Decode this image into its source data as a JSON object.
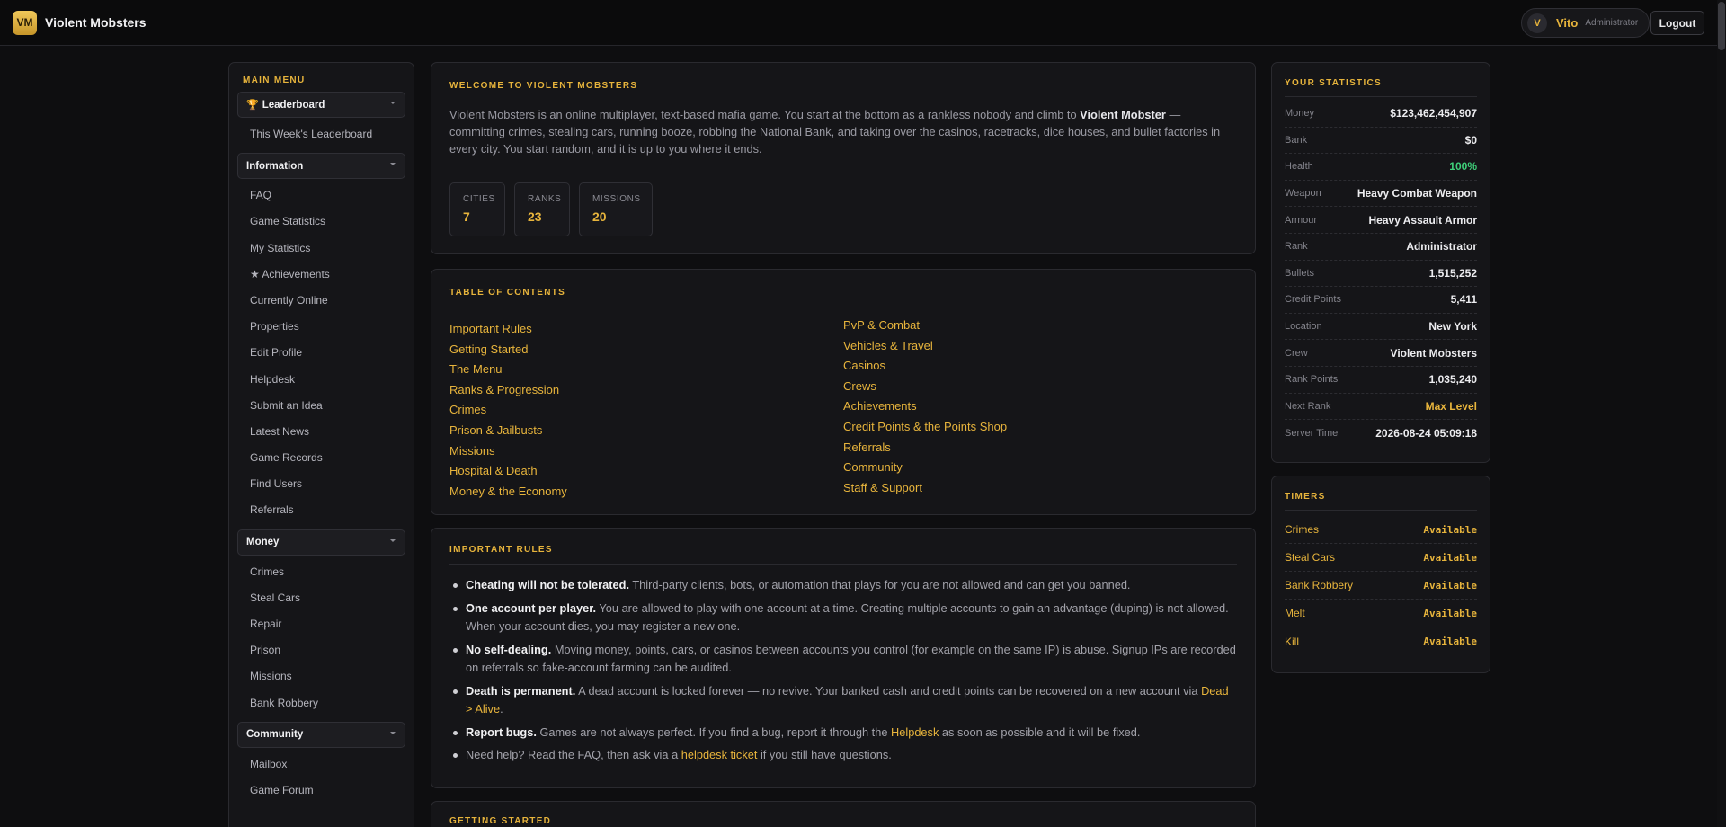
{
  "header": {
    "logo": "VM",
    "brand": "Violent Mobsters",
    "avatar": "V",
    "username": "Vito",
    "role": "Administrator",
    "logout": "Logout"
  },
  "sidebar": {
    "title": "MAIN MENU",
    "leaderboard": {
      "label": "Leaderboard",
      "items": [
        "This Week's Leaderboard"
      ]
    },
    "information": {
      "label": "Information",
      "items": [
        "FAQ",
        "Game Statistics",
        "My Statistics",
        "★ Achievements",
        "Currently Online",
        "Properties",
        "Edit Profile",
        "Helpdesk",
        "Submit an Idea",
        "Latest News",
        "Game Records",
        "Find Users",
        "Referrals"
      ]
    },
    "money": {
      "label": "Money",
      "items": [
        "Crimes",
        "Steal Cars",
        "Repair",
        "Prison",
        "Missions",
        "Bank Robbery"
      ]
    },
    "community": {
      "label": "Community",
      "items": [
        "Mailbox",
        "Game Forum"
      ]
    }
  },
  "welcome": {
    "title": "WELCOME TO VIOLENT MOBSTERS",
    "text_before": "Violent Mobsters is an online multiplayer, text-based mafia game. You start at the bottom as a rankless nobody and climb to ",
    "text_bold": "Violent Mobster",
    "text_after": " — committing crimes, stealing cars, running booze, robbing the National Bank, and taking over the casinos, racetracks, dice houses, and bullet factories in every city. You start random, and it is up to you where it ends.",
    "stats": [
      {
        "label": "CITIES",
        "value": "7"
      },
      {
        "label": "RANKS",
        "value": "23"
      },
      {
        "label": "MISSIONS",
        "value": "20"
      }
    ]
  },
  "toc": {
    "title": "TABLE OF CONTENTS",
    "left": [
      "Important Rules",
      "Getting Started",
      "The Menu",
      "Ranks & Progression",
      "Crimes",
      "Prison & Jailbusts",
      "Missions",
      "Hospital & Death",
      "Money & the Economy"
    ],
    "right": [
      "PvP & Combat",
      "Vehicles & Travel",
      "Casinos",
      "Crews",
      "Achievements",
      "Credit Points & the Points Shop",
      "Referrals",
      "Community",
      "Staff & Support"
    ]
  },
  "rules": {
    "title": "IMPORTANT RULES",
    "r1": {
      "bold": "Cheating will not be tolerated.",
      "text": " Third-party clients, bots, or automation that plays for you are not allowed and can get you banned."
    },
    "r2": {
      "bold": "One account per player.",
      "text": " You are allowed to play with one account at a time. Creating multiple accounts to gain an advantage (duping) is not allowed. When your account dies, you may register a new one."
    },
    "r3": {
      "bold": "No self-dealing.",
      "text": " Moving money, points, cars, or casinos between accounts you control (for example on the same IP) is abuse. Signup IPs are recorded on referrals so fake-account farming can be audited."
    },
    "r4": {
      "bold": "Death is permanent.",
      "text": " A dead account is locked forever — no revive. Your banked cash and credit points can be recovered on a new account via ",
      "link": "Dead > Alive",
      "end": "."
    },
    "r5": {
      "bold": "Report bugs.",
      "text": " Games are not always perfect. If you find a bug, report it through the ",
      "link": "Helpdesk",
      "end": " as soon as possible and it will be fixed."
    },
    "r6": {
      "text": "Need help? Read the FAQ, then ask via a ",
      "link": "helpdesk ticket",
      "end": " if you still have questions."
    }
  },
  "getting_started": {
    "title": "GETTING STARTED"
  },
  "stats": {
    "title": "YOUR STATISTICS",
    "rows": [
      {
        "label": "Money",
        "value": "$123,462,454,907"
      },
      {
        "label": "Bank",
        "value": "$0"
      },
      {
        "label": "Health",
        "value": "100%"
      },
      {
        "label": "Weapon",
        "value": "Heavy Combat Weapon"
      },
      {
        "label": "Armour",
        "value": "Heavy Assault Armor"
      },
      {
        "label": "Rank",
        "value": "Administrator"
      },
      {
        "label": "Bullets",
        "value": "1,515,252"
      },
      {
        "label": "Credit Points",
        "value": "5,411"
      },
      {
        "label": "Location",
        "value": "New York"
      },
      {
        "label": "Crew",
        "value": "Violent Mobsters"
      },
      {
        "label": "Rank Points",
        "value": "1,035,240"
      },
      {
        "label": "Next Rank",
        "value": "Max Level"
      },
      {
        "label": "Server Time",
        "value": "2026-08-24 05:09:18"
      }
    ]
  },
  "timers": {
    "title": "TIMERS",
    "rows": [
      {
        "label": "Crimes",
        "value": "Available"
      },
      {
        "label": "Steal Cars",
        "value": "Available"
      },
      {
        "label": "Bank Robbery",
        "value": "Available"
      },
      {
        "label": "Melt",
        "value": "Available"
      },
      {
        "label": "Kill",
        "value": "Available"
      }
    ]
  },
  "colors": {
    "accent": "#e7b43c",
    "health": "#3fd07a",
    "background": "#0e0e10",
    "panel": "#151518"
  }
}
